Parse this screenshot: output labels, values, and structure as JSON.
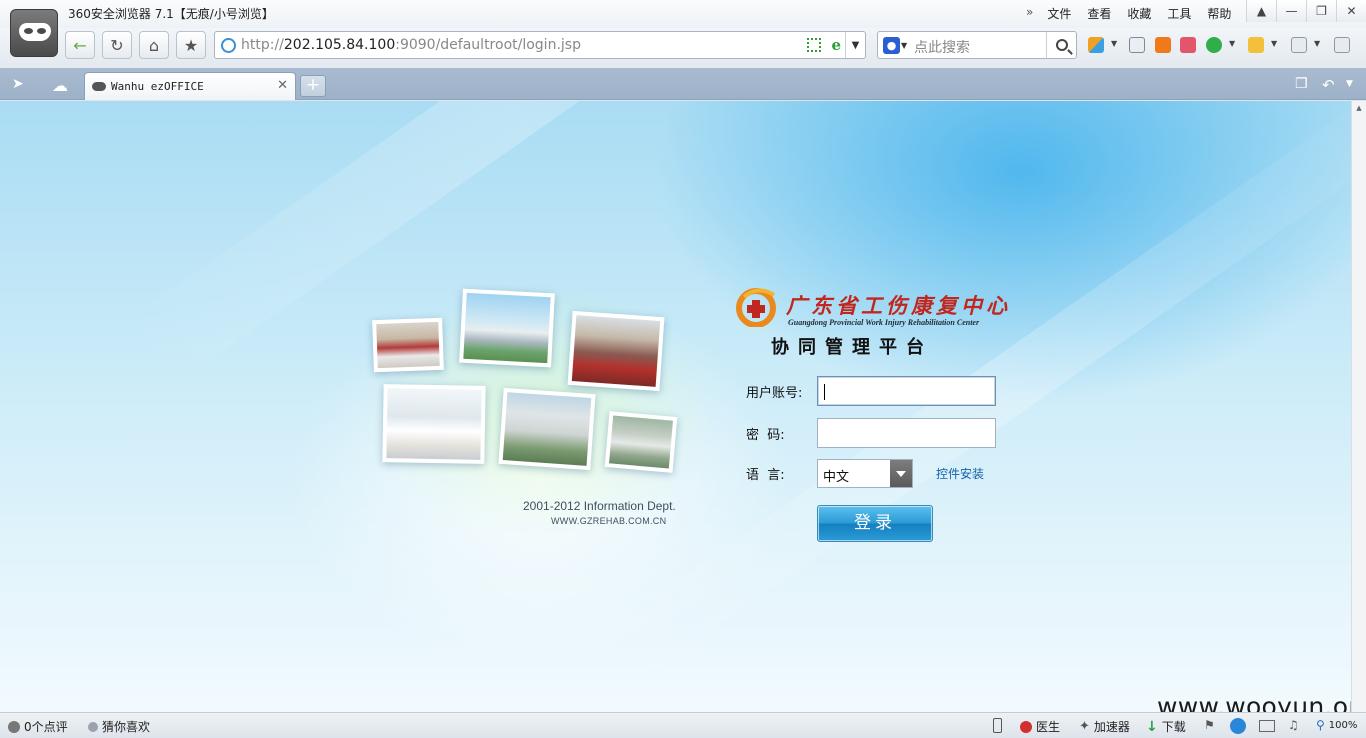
{
  "window": {
    "title": "360安全浏览器 7.1【无痕/小号浏览】",
    "menu": [
      "文件",
      "查看",
      "收藏",
      "工具",
      "帮助"
    ],
    "menu_overflow": "»"
  },
  "toolbar": {
    "url_scheme": "http://",
    "url_host": "202.105.84.100",
    "url_rest": ":9090/defaultroot/login.jsp",
    "search_placeholder": "点此搜索"
  },
  "tabs": [
    {
      "label": "Wanhu ezOFFICE",
      "active": true
    }
  ],
  "page": {
    "org_name_cn": "广东省工伤康复中心",
    "org_name_en": "Guangdong Provincial Work Injury Rehabilitation Center",
    "platform_title": "协同管理平台",
    "copyright": "2001-2012 Information Dept.",
    "site": "WWW.GZREHAB.COM.CN",
    "form": {
      "username_label": "用户账号:",
      "username_value": "",
      "password_label": "密  码:",
      "password_value": "",
      "language_label": "语  言:",
      "language_selected": "中文",
      "plugin_link": "控件安装",
      "login_button": "登录"
    },
    "watermark": "www.wooyun.org"
  },
  "statusbar": {
    "comments": "0个点评",
    "guess": "猜你喜欢",
    "doctor": "医生",
    "accelerator": "加速器",
    "download": "下载",
    "zoom": "100%"
  },
  "colors": {
    "brand_red": "#c0281f",
    "login_button": "#2c9bd6",
    "link": "#1760a8"
  }
}
